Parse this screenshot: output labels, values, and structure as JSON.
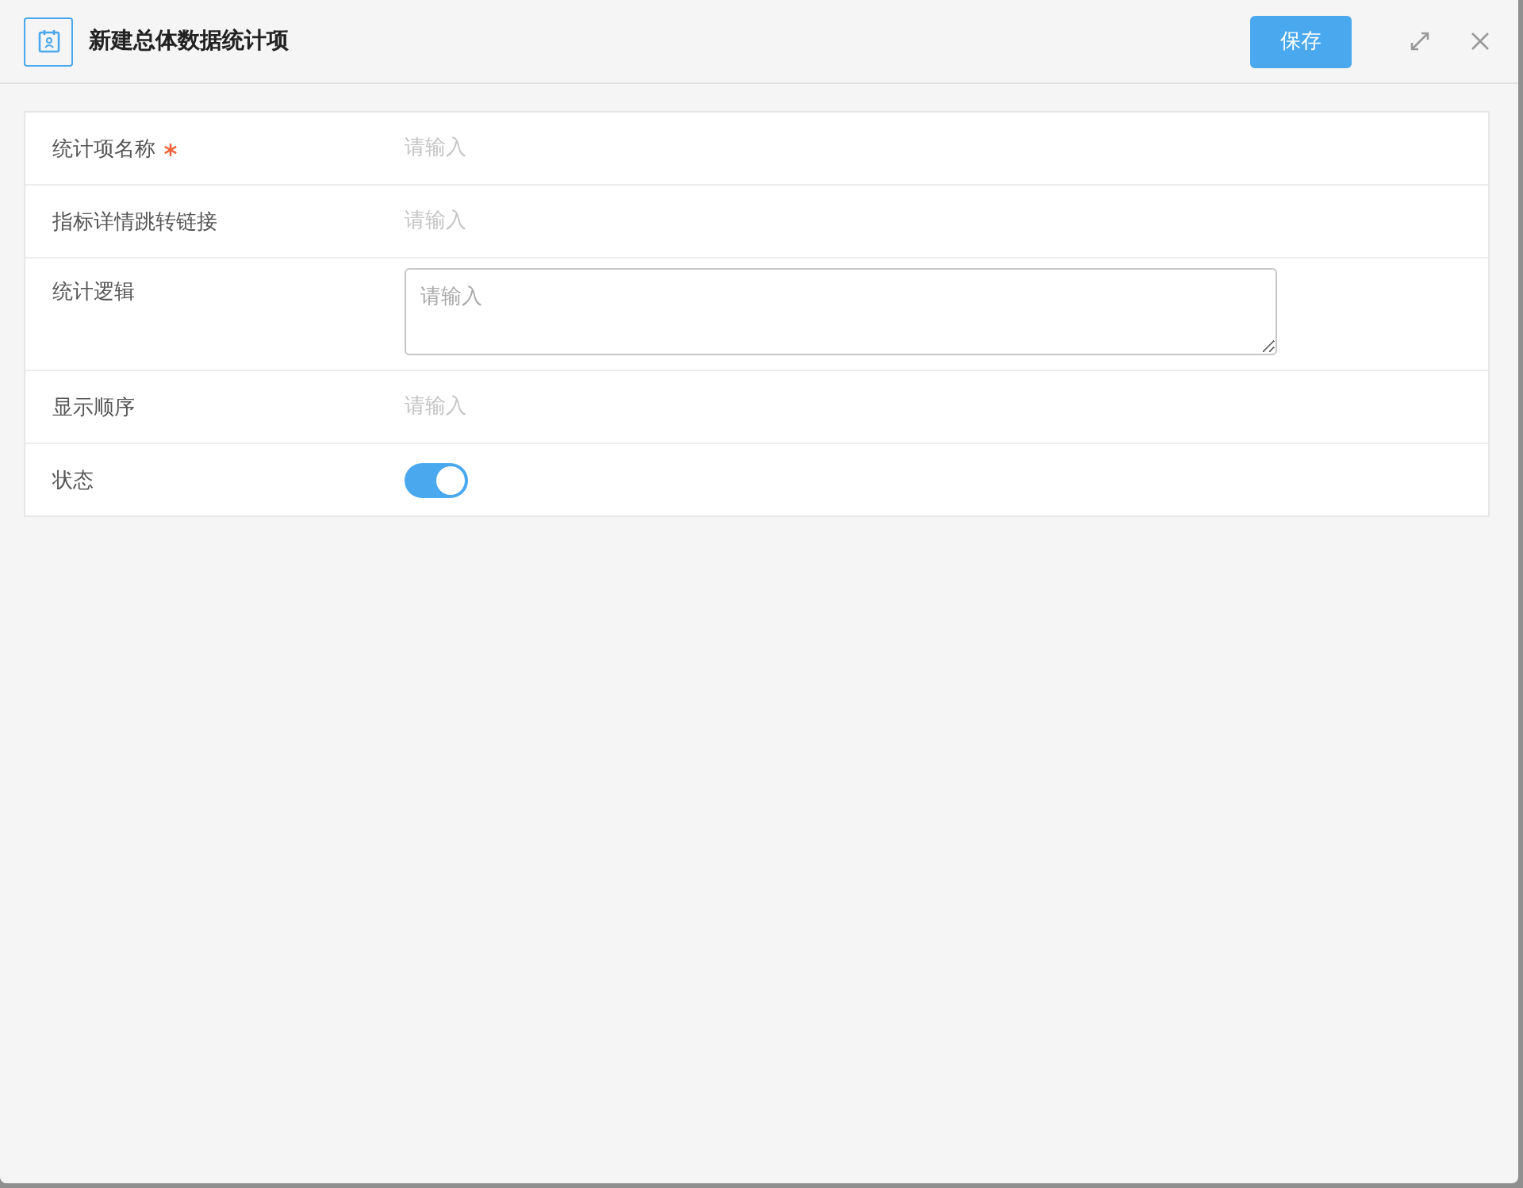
{
  "dialog": {
    "title": "新建总体数据统计项",
    "save_button": "保存"
  },
  "fields": [
    {
      "kind": "input",
      "label": "统计项名称",
      "required": true,
      "placeholder": "请输入"
    },
    {
      "kind": "input",
      "label": "指标详情跳转链接",
      "required": false,
      "placeholder": "请输入"
    },
    {
      "kind": "textarea",
      "label": "统计逻辑",
      "required": false,
      "placeholder": "请输入"
    },
    {
      "kind": "input",
      "label": "显示顺序",
      "required": false,
      "placeholder": "请输入"
    },
    {
      "kind": "switch",
      "label": "状态",
      "required": false,
      "on": true
    }
  ]
}
